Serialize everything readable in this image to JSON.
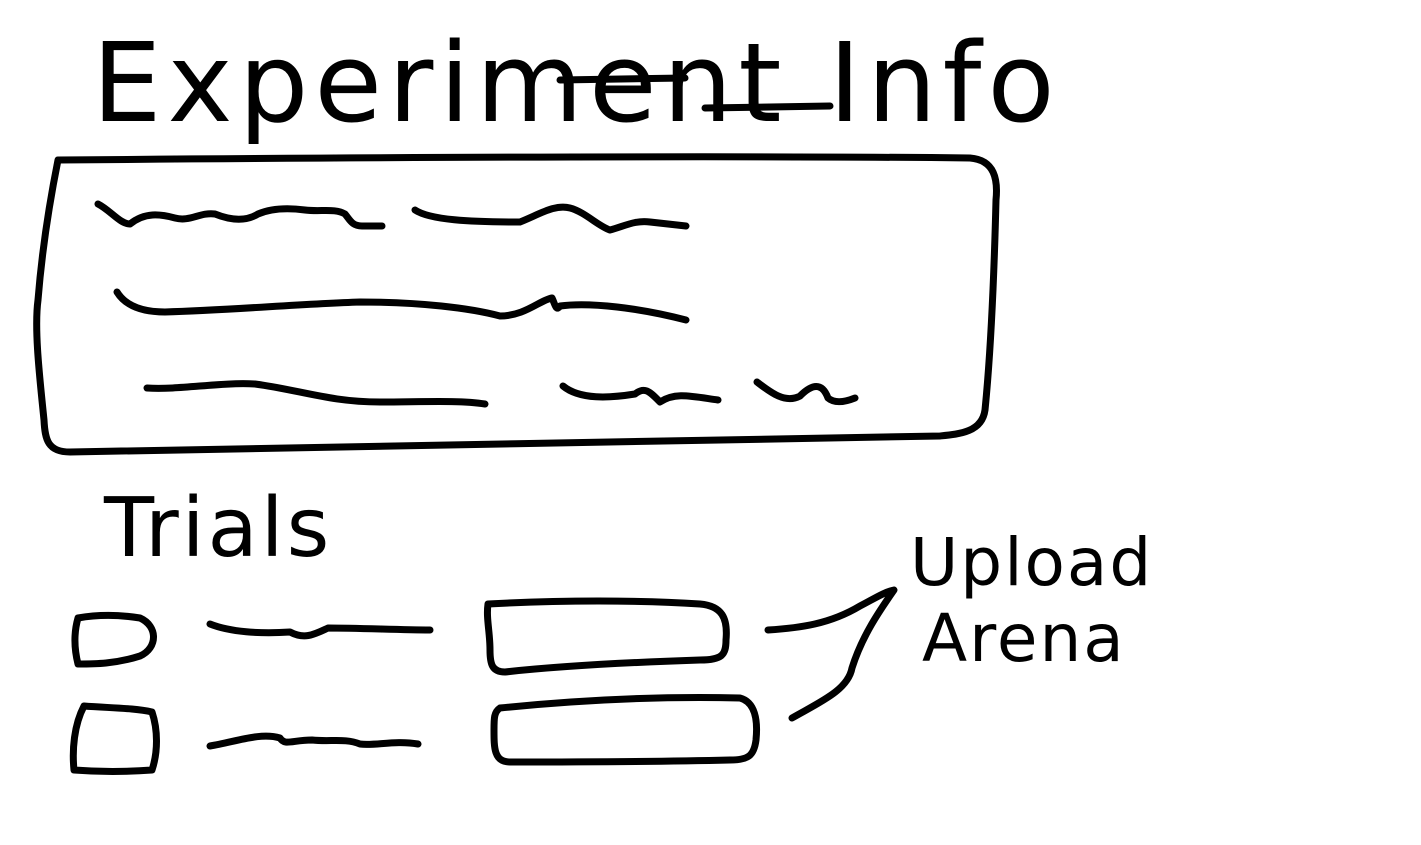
{
  "header": {
    "title": "Experiment Info"
  },
  "trials": {
    "heading": "Trials",
    "rows": [
      {},
      {}
    ]
  },
  "callout": {
    "line1": "Upload",
    "line2": "Arena"
  },
  "colors": {
    "ink": "#000000",
    "paper": "#ffffff"
  }
}
